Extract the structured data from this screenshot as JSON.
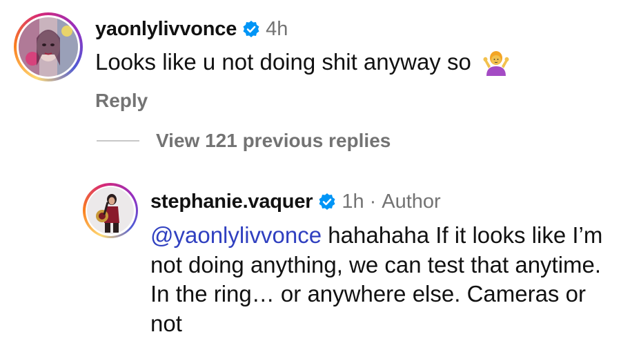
{
  "comment1": {
    "username": "yaonlylivvonce",
    "time": "4h",
    "text": "Looks like u not doing shit anyway so",
    "emoji_icon": "person-shrugging-icon",
    "reply_label": "Reply"
  },
  "view_replies": {
    "label": "View 121 previous replies"
  },
  "comment2": {
    "username": "stephanie.vaquer",
    "time": "1h",
    "separator": "·",
    "badge": "Author",
    "mention": "@yaonlylivvonce",
    "text": " hahahaha  If it looks like I’m not doing anything, we can test that anytime. In the ring… or anywhere else. Cameras or not"
  },
  "colors": {
    "verified": "#0095f6",
    "mention": "#3040c0",
    "muted": "#737373"
  }
}
